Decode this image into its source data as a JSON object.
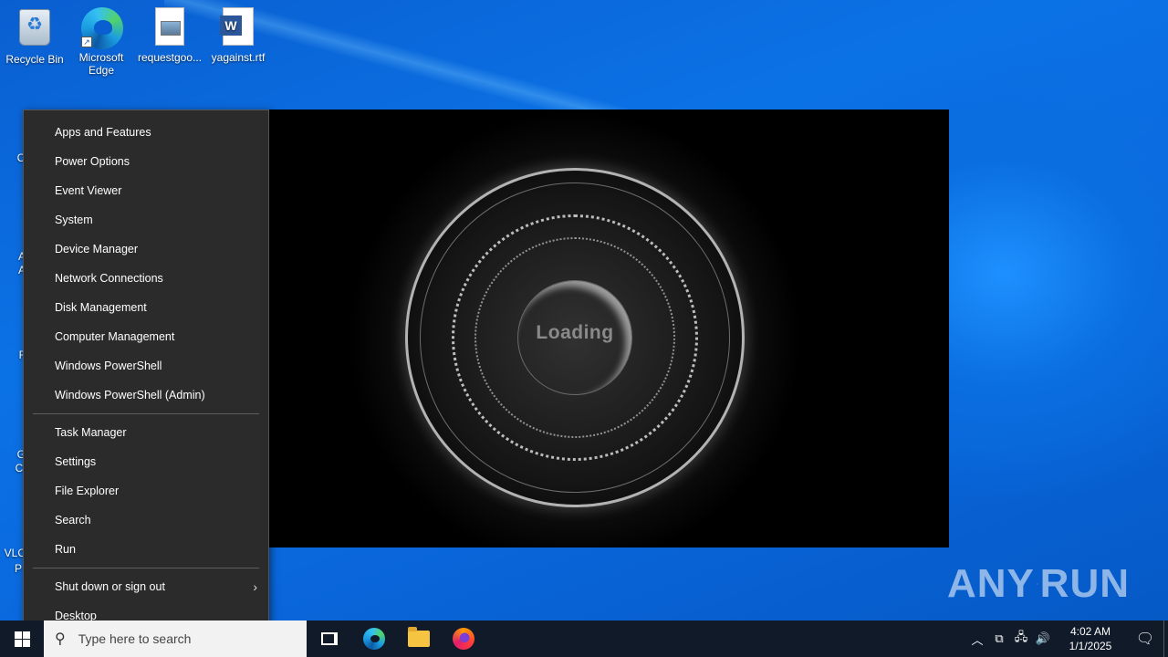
{
  "desktop": {
    "icons": [
      {
        "label": "Recycle Bin"
      },
      {
        "label": "Microsoft Edge"
      },
      {
        "label": "requestgoo..."
      },
      {
        "label": "yagainst.rtf"
      }
    ],
    "partial_labels": [
      "CC",
      "A",
      "A",
      "F",
      "G",
      "Cl",
      "VLC",
      "P"
    ]
  },
  "loader": {
    "text": "Loading"
  },
  "context_menu": {
    "group1": [
      "Apps and Features",
      "Power Options",
      "Event Viewer",
      "System",
      "Device Manager",
      "Network Connections",
      "Disk Management",
      "Computer Management",
      "Windows PowerShell",
      "Windows PowerShell (Admin)"
    ],
    "group2": [
      "Task Manager",
      "Settings",
      "File Explorer",
      "Search",
      "Run"
    ],
    "group3": [
      "Shut down or sign out",
      "Desktop"
    ]
  },
  "watermark": {
    "text_left": "ANY",
    "text_right": "RUN"
  },
  "taskbar": {
    "search_placeholder": "Type here to search",
    "clock_time": "4:02 AM",
    "clock_date": "1/1/2025",
    "pinned": [
      "task-view-icon",
      "edge-icon",
      "file-explorer-icon",
      "firefox-icon"
    ]
  }
}
